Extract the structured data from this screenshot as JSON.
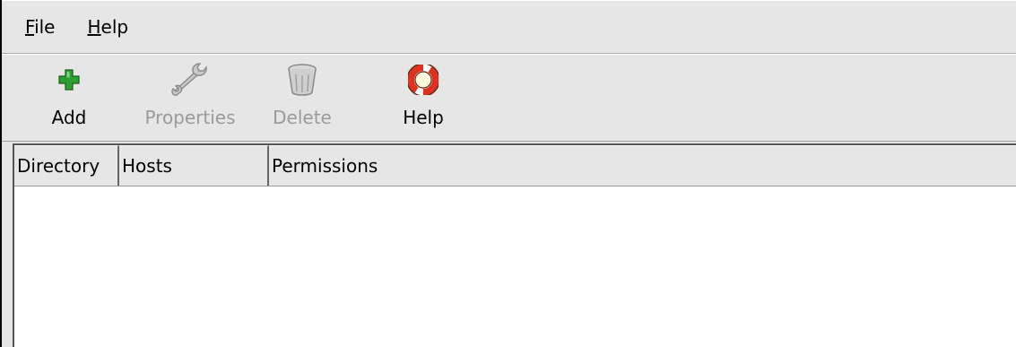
{
  "menu": [
    {
      "mnemonic": "F",
      "rest": "ile"
    },
    {
      "mnemonic": "H",
      "rest": "elp"
    }
  ],
  "toolbar": {
    "add_label": "Add",
    "properties_label": "Properties",
    "delete_label": "Delete",
    "help_label": "Help"
  },
  "colors": {
    "add_icon": "#2e9e2e",
    "help_icon": "#e03020",
    "disabled_text": "#9a9a9a"
  },
  "table": {
    "columns": [
      "Directory",
      "Hosts",
      "Permissions"
    ],
    "rows": []
  }
}
